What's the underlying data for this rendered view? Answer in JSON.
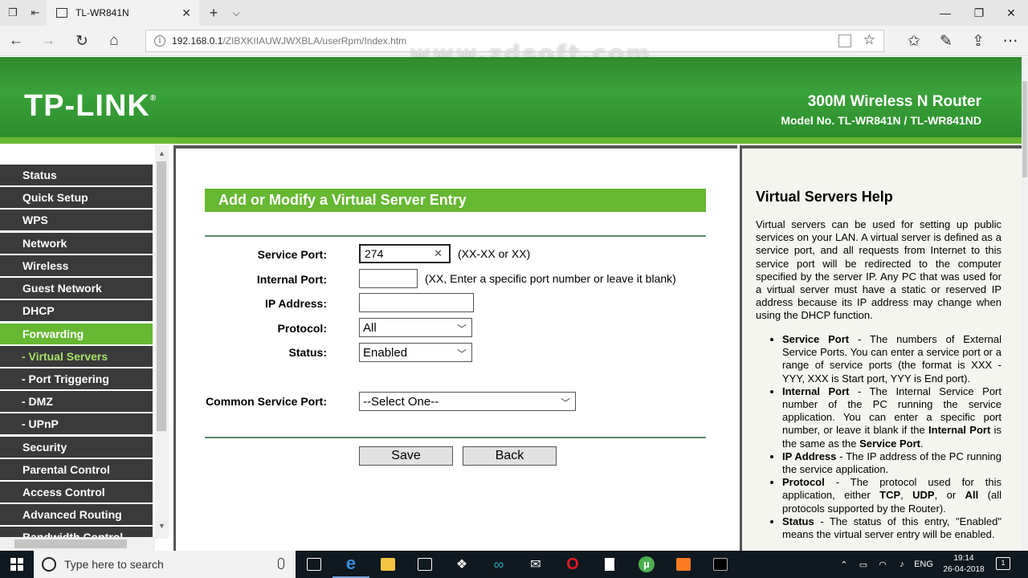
{
  "browser": {
    "tab_title": "TL-WR841N",
    "tab_close": "✕",
    "new_tab": "+",
    "tab_menu": "⌵",
    "win_min": "—",
    "win_restore": "❐",
    "win_close": "✕",
    "url_host": "192.168.0.1",
    "url_path": "/ZIBXKIIAUWJWXBLA/userRpm/Index.htm",
    "watermark": "www.zdsoft.com"
  },
  "header": {
    "logo": "TP-LINK",
    "logo_mark": "®",
    "product": "300M Wireless N Router",
    "model": "Model No. TL-WR841N / TL-WR841ND"
  },
  "menu": [
    {
      "label": "Status"
    },
    {
      "label": "Quick Setup"
    },
    {
      "label": "WPS"
    },
    {
      "label": "Network"
    },
    {
      "label": "Wireless"
    },
    {
      "label": "Guest Network"
    },
    {
      "label": "DHCP"
    },
    {
      "label": "Forwarding"
    },
    {
      "label": "- Virtual Servers"
    },
    {
      "label": "- Port Triggering"
    },
    {
      "label": "- DMZ"
    },
    {
      "label": "- UPnP"
    },
    {
      "label": "Security"
    },
    {
      "label": "Parental Control"
    },
    {
      "label": "Access Control"
    },
    {
      "label": "Advanced Routing"
    },
    {
      "label": "Bandwidth Control"
    }
  ],
  "form": {
    "title": "Add or Modify a Virtual Server Entry",
    "service_port_label": "Service Port:",
    "service_port_value": "274",
    "service_port_hint": "(XX-XX or XX)",
    "internal_port_label": "Internal Port:",
    "internal_port_value": "",
    "internal_port_hint": "(XX, Enter a specific port number or leave it blank)",
    "ip_label": "IP Address:",
    "ip_value": "",
    "protocol_label": "Protocol:",
    "protocol_value": "All",
    "status_label": "Status:",
    "status_value": "Enabled",
    "common_label": "Common Service Port:",
    "common_value": "--Select One--",
    "save": "Save",
    "back": "Back"
  },
  "help": {
    "title": "Virtual Servers Help",
    "intro": "Virtual servers can be used for setting up public services on your LAN. A virtual server is defined as a service port, and all requests from Internet to this service port will be redirected to the computer specified by the server IP. Any PC that was used for a virtual server must have a static or reserved IP address because its IP address may change when using the DHCP function.",
    "items": [
      {
        "term": "Service Port",
        "text": " - The numbers of External Service Ports. You can enter a service port or a range of service ports (the format is XXX - YYY, XXX is Start port, YYY is End port)."
      },
      {
        "term": "Internal Port",
        "text": " - The Internal Service Port number of the PC running the service application. You can enter a specific port number, or leave it blank if the ",
        "term2": "Internal Port",
        "text2": " is the same as the ",
        "term3": "Service Port",
        "text3": "."
      },
      {
        "term": "IP Address",
        "text": " - The IP address of the PC running the service application."
      },
      {
        "term": "Protocol",
        "text": " - The protocol used for this application, either ",
        "b1": "TCP",
        "c1": ", ",
        "b2": "UDP",
        "c2": ", or ",
        "b3": "All",
        "c3": " (all protocols supported by the Router)."
      },
      {
        "term": "Status",
        "text": " - The status of this entry, \"Enabled\" means the virtual server entry will be enabled."
      }
    ]
  },
  "taskbar": {
    "search_placeholder": "Type here to search",
    "lang": "ENG",
    "time": "19:14",
    "date": "26-04-2018",
    "notifications": "1"
  },
  "colors": {
    "accent_green": "#66b832",
    "menu_bg": "#3a3a3a",
    "header_green": "#3aa23a"
  }
}
